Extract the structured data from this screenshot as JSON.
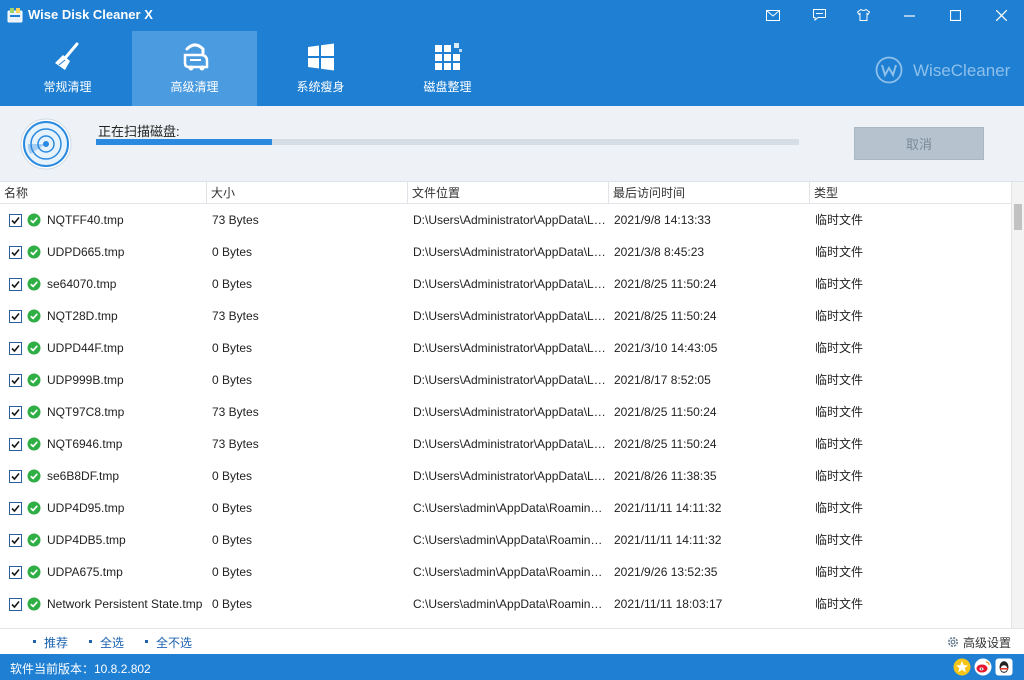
{
  "window": {
    "title": "Wise Disk Cleaner X"
  },
  "window_controls": [
    "mail-icon",
    "feedback-icon",
    "skin-icon",
    "minimize-icon",
    "maximize-icon",
    "close-icon"
  ],
  "tabs": [
    {
      "label": "常规清理",
      "icon": "broom-icon",
      "active": false
    },
    {
      "label": "高级清理",
      "icon": "vacuum-icon",
      "active": true
    },
    {
      "label": "系统瘦身",
      "icon": "windows-icon",
      "active": false
    },
    {
      "label": "磁盘整理",
      "icon": "defrag-icon",
      "active": false
    }
  ],
  "brand": {
    "text": "WiseCleaner",
    "logo": "w"
  },
  "scan": {
    "status": "正在扫描磁盘:",
    "progress": 0.25,
    "cancel_label": "取消"
  },
  "table": {
    "columns": [
      "名称",
      "大小",
      "文件位置",
      "最后访问时间",
      "类型"
    ],
    "rows": [
      {
        "name": "NQTFF40.tmp",
        "size": "73 Bytes",
        "path": "D:\\Users\\Administrator\\AppData\\Local\\Temp",
        "time": "2021/9/8 14:13:33",
        "type": "临时文件"
      },
      {
        "name": "UDPD665.tmp",
        "size": "0 Bytes",
        "path": "D:\\Users\\Administrator\\AppData\\Local\\Temp",
        "time": "2021/3/8 8:45:23",
        "type": "临时文件"
      },
      {
        "name": "se64070.tmp",
        "size": "0 Bytes",
        "path": "D:\\Users\\Administrator\\AppData\\Local\\Temp",
        "time": "2021/8/25 11:50:24",
        "type": "临时文件"
      },
      {
        "name": "NQT28D.tmp",
        "size": "73 Bytes",
        "path": "D:\\Users\\Administrator\\AppData\\Local\\Temp",
        "time": "2021/8/25 11:50:24",
        "type": "临时文件"
      },
      {
        "name": "UDPD44F.tmp",
        "size": "0 Bytes",
        "path": "D:\\Users\\Administrator\\AppData\\Local\\Temp",
        "time": "2021/3/10 14:43:05",
        "type": "临时文件"
      },
      {
        "name": "UDP999B.tmp",
        "size": "0 Bytes",
        "path": "D:\\Users\\Administrator\\AppData\\Local\\Temp",
        "time": "2021/8/17 8:52:05",
        "type": "临时文件"
      },
      {
        "name": "NQT97C8.tmp",
        "size": "73 Bytes",
        "path": "D:\\Users\\Administrator\\AppData\\Local\\Temp",
        "time": "2021/8/25 11:50:24",
        "type": "临时文件"
      },
      {
        "name": "NQT6946.tmp",
        "size": "73 Bytes",
        "path": "D:\\Users\\Administrator\\AppData\\Local\\Temp",
        "time": "2021/8/25 11:50:24",
        "type": "临时文件"
      },
      {
        "name": "se6B8DF.tmp",
        "size": "0 Bytes",
        "path": "D:\\Users\\Administrator\\AppData\\Local\\Temp",
        "time": "2021/8/26 11:38:35",
        "type": "临时文件"
      },
      {
        "name": "UDP4D95.tmp",
        "size": "0 Bytes",
        "path": "C:\\Users\\admin\\AppData\\Roaming\\Temp",
        "time": "2021/11/11 14:11:32",
        "type": "临时文件"
      },
      {
        "name": "UDP4DB5.tmp",
        "size": "0 Bytes",
        "path": "C:\\Users\\admin\\AppData\\Roaming\\Temp",
        "time": "2021/11/11 14:11:32",
        "type": "临时文件"
      },
      {
        "name": "UDPA675.tmp",
        "size": "0 Bytes",
        "path": "C:\\Users\\admin\\AppData\\Roaming\\Temp",
        "time": "2021/9/26 13:52:35",
        "type": "临时文件"
      },
      {
        "name": "Network Persistent State.tmp",
        "size": "0 Bytes",
        "path": "C:\\Users\\admin\\AppData\\Roaming\\Temp",
        "time": "2021/11/11 18:03:17",
        "type": "临时文件"
      }
    ]
  },
  "footer": {
    "recommend": "推荐",
    "select_all": "全选",
    "select_none": "全不选",
    "advanced": "高级设置"
  },
  "status": {
    "version": "软件当前版本：10.8.2.802",
    "icons": [
      "rate-star-icon",
      "weibo-icon",
      "qq-icon"
    ]
  },
  "colors": {
    "header_blue": "#1e7fd3",
    "active_tab": "#4a9be0",
    "check_green": "#2fae44",
    "link_blue": "#1c62b0"
  }
}
